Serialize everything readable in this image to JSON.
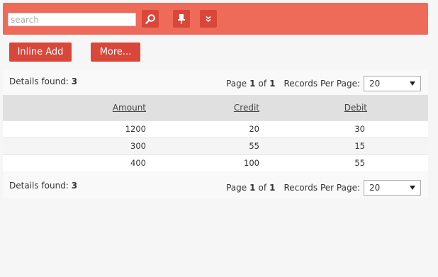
{
  "toolbar": {
    "search_placeholder": "search",
    "search_icon": "search-icon",
    "pin_icon": "pin-icon",
    "expand_icon": "double-chevron-down-icon",
    "bg_color": "#ee6b59",
    "button_color": "#d9473a"
  },
  "actions": {
    "inline_add": "Inline Add",
    "more": "More..."
  },
  "top_bar": {
    "details_label": "Details found:",
    "details_count": "3",
    "page_label": "Page",
    "page_current": "1",
    "page_of": "of",
    "page_total": "1",
    "records_label": "Records Per Page:",
    "records_value": "20"
  },
  "bottom_bar": {
    "details_label": "Details found:",
    "details_count": "3",
    "page_label": "Page",
    "page_current": "1",
    "page_of": "of",
    "page_total": "1",
    "records_label": "Records Per Page:",
    "records_value": "20"
  },
  "table": {
    "headers": [
      "Amount",
      "Credit",
      "Debit"
    ],
    "rows": [
      [
        "1200",
        "20",
        "30"
      ],
      [
        "300",
        "55",
        "15"
      ],
      [
        "400",
        "100",
        "55"
      ]
    ]
  }
}
